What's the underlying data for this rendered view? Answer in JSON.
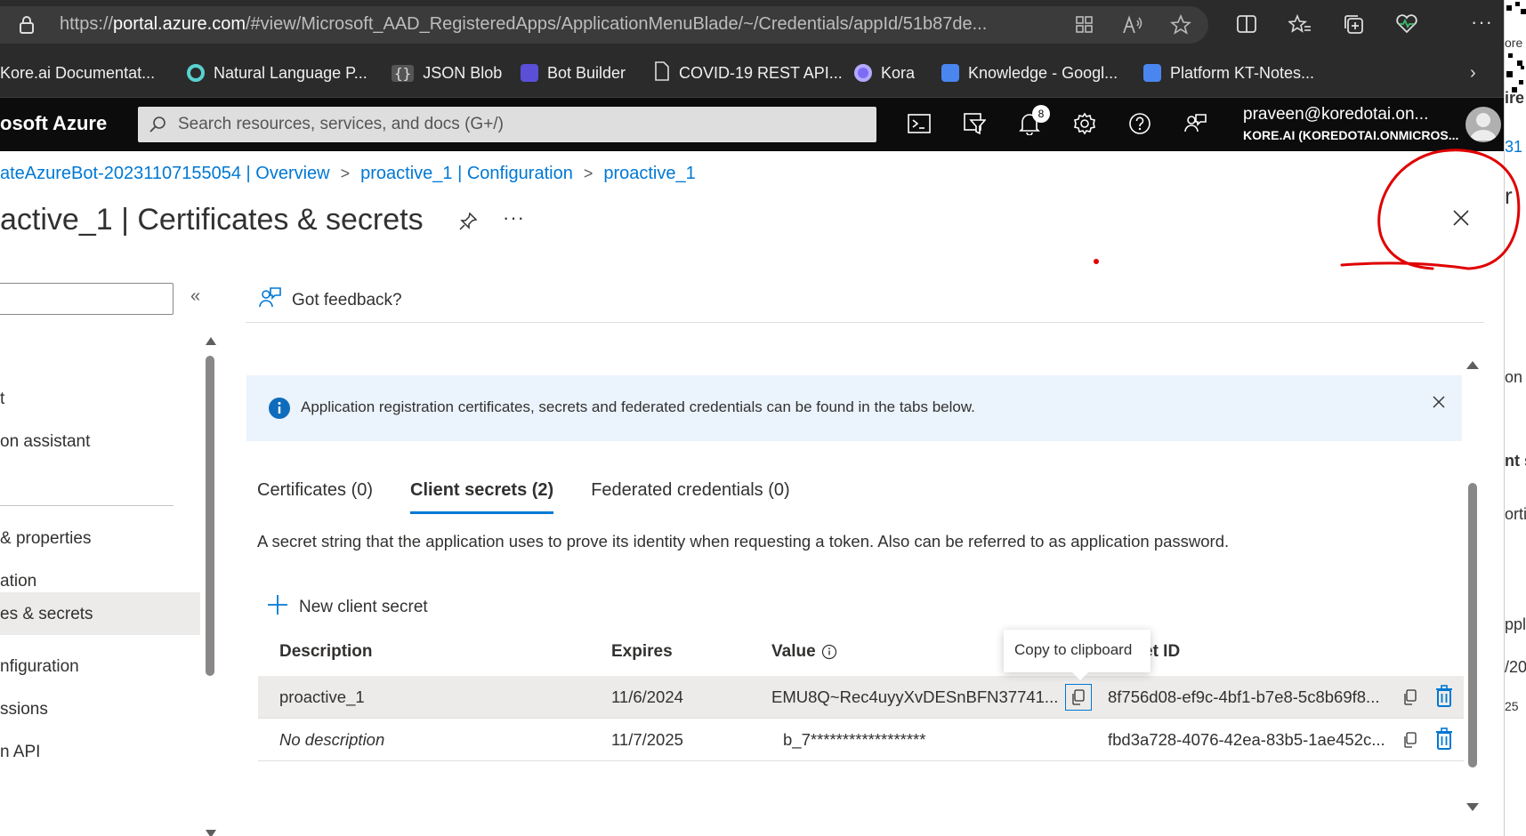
{
  "browser": {
    "url_prefix": "https://",
    "url_host": "portal.azure.com",
    "url_rest": "/#view/Microsoft_AAD_RegisteredApps/ApplicationMenuBlade/~/Credentials/appId/51b87de...",
    "more": "···",
    "bookmarks": [
      {
        "label": "Kore.ai Documentat...",
        "icon": "kore-icon"
      },
      {
        "label": "Natural Language P...",
        "icon": "nlp-icon"
      },
      {
        "label": "JSON Blob",
        "icon": "json-icon"
      },
      {
        "label": "Bot Builder",
        "icon": "botbuilder-icon"
      },
      {
        "label": "COVID-19 REST API...",
        "icon": "document-icon"
      },
      {
        "label": "Kora",
        "icon": "kora-icon"
      },
      {
        "label": "Knowledge - Googl...",
        "icon": "gdoc-icon"
      },
      {
        "label": "Platform KT-Notes...",
        "icon": "gdoc-icon"
      }
    ],
    "bookmarks_more": "›"
  },
  "azure": {
    "brand": "osoft Azure",
    "search_placeholder": "Search resources, services, and docs (G+/)",
    "notification_count": "8",
    "user_email": "praveen@koredotai.on...",
    "user_tenant": "KORE.AI (KOREDOTAI.ONMICROS..."
  },
  "breadcrumb": [
    "ateAzureBot-20231107155054 | Overview",
    "proactive_1 | Configuration",
    "proactive_1"
  ],
  "page": {
    "title": "active_1 | Certificates & secrets",
    "more": "···"
  },
  "nav": {
    "collapse": "«",
    "items": [
      "t",
      "on assistant",
      "& properties",
      "ation",
      "es & secrets",
      "nfiguration",
      "ssions",
      "n API"
    ]
  },
  "content": {
    "feedback": "Got feedback?",
    "info_banner": "Application registration certificates, secrets and federated credentials can be found in the tabs below.",
    "tabs": [
      "Certificates (0)",
      "Client secrets (2)",
      "Federated credentials (0)"
    ],
    "active_tab": 1,
    "description": "A secret string that the application uses to prove its identity when requesting a token. Also can be referred to as application password.",
    "new_secret": "New client secret",
    "table": {
      "headers": [
        "Description",
        "Expires",
        "Value",
        "et ID"
      ],
      "rows": [
        {
          "description": "proactive_1",
          "expires": "11/6/2024",
          "value": "EMU8Q~Rec4uyyXvDESnBFN37741...",
          "secret_id": "8f756d08-ef9c-4bf1-b7e8-5c8b69f8..."
        },
        {
          "description": "No description",
          "expires": "11/7/2025",
          "value": "b_7******************",
          "secret_id": "fbd3a728-4076-42ea-83b5-1ae452c..."
        }
      ]
    },
    "tooltip": "Copy to clipboard"
  },
  "right_strip": [
    "ore",
    "ire",
    "31",
    "r",
    "on",
    "nt s",
    "orti",
    "ppl",
    "/20",
    "25"
  ],
  "colors": {
    "accent": "#0078d4",
    "annotation": "#e00000",
    "delete": "#0078d4"
  }
}
